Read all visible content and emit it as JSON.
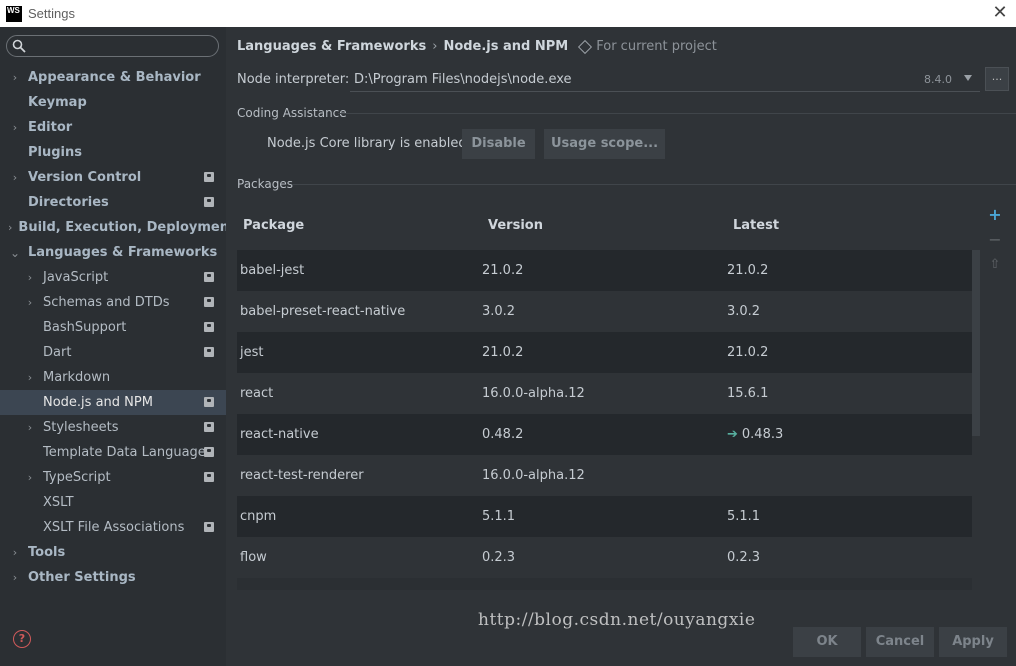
{
  "window": {
    "app_logo": "WS",
    "title": "Settings"
  },
  "sidebar": {
    "items": [
      {
        "label": "Appearance & Behavior",
        "level": 0,
        "expandable": true,
        "expanded": false,
        "project": false,
        "selected": false
      },
      {
        "label": "Keymap",
        "level": 0,
        "expandable": false,
        "project": false,
        "selected": false
      },
      {
        "label": "Editor",
        "level": 0,
        "expandable": true,
        "expanded": false,
        "project": false,
        "selected": false
      },
      {
        "label": "Plugins",
        "level": 0,
        "expandable": false,
        "project": false,
        "selected": false
      },
      {
        "label": "Version Control",
        "level": 0,
        "expandable": true,
        "expanded": false,
        "project": true,
        "selected": false
      },
      {
        "label": "Directories",
        "level": 0,
        "expandable": false,
        "project": true,
        "selected": false
      },
      {
        "label": "Build, Execution, Deployment",
        "level": 0,
        "expandable": true,
        "expanded": false,
        "project": false,
        "selected": false
      },
      {
        "label": "Languages & Frameworks",
        "level": 0,
        "expandable": true,
        "expanded": true,
        "project": false,
        "selected": false
      },
      {
        "label": "JavaScript",
        "level": 1,
        "expandable": true,
        "expanded": false,
        "project": true,
        "selected": false
      },
      {
        "label": "Schemas and DTDs",
        "level": 1,
        "expandable": true,
        "expanded": false,
        "project": true,
        "selected": false
      },
      {
        "label": "BashSupport",
        "level": 1,
        "expandable": false,
        "project": true,
        "selected": false
      },
      {
        "label": "Dart",
        "level": 1,
        "expandable": false,
        "project": true,
        "selected": false
      },
      {
        "label": "Markdown",
        "level": 1,
        "expandable": true,
        "expanded": false,
        "project": false,
        "selected": false
      },
      {
        "label": "Node.js and NPM",
        "level": 1,
        "expandable": false,
        "project": true,
        "selected": true
      },
      {
        "label": "Stylesheets",
        "level": 1,
        "expandable": true,
        "expanded": false,
        "project": true,
        "selected": false
      },
      {
        "label": "Template Data Languages",
        "level": 1,
        "expandable": false,
        "project": true,
        "selected": false
      },
      {
        "label": "TypeScript",
        "level": 1,
        "expandable": true,
        "expanded": false,
        "project": true,
        "selected": false
      },
      {
        "label": "XSLT",
        "level": 1,
        "expandable": false,
        "project": false,
        "selected": false
      },
      {
        "label": "XSLT File Associations",
        "level": 1,
        "expandable": false,
        "project": true,
        "selected": false
      },
      {
        "label": "Tools",
        "level": 0,
        "expandable": true,
        "expanded": false,
        "project": false,
        "selected": false
      },
      {
        "label": "Other Settings",
        "level": 0,
        "expandable": true,
        "expanded": false,
        "project": false,
        "selected": false
      }
    ],
    "help_icon": "?"
  },
  "breadcrumb": {
    "parent": "Languages & Frameworks",
    "separator": "›",
    "current": "Node.js and NPM",
    "scope": "For current project"
  },
  "interpreter": {
    "label": "Node interpreter:",
    "path": "D:\\Program Files\\nodejs\\node.exe",
    "version": "8.4.0",
    "browse_label": "..."
  },
  "coding_assistance": {
    "title": "Coding Assistance",
    "core_text": "Node.js Core library is enabled.",
    "disable_label": "Disable",
    "scope_label": "Usage scope..."
  },
  "packages": {
    "title": "Packages",
    "columns": [
      "Package",
      "Version",
      "Latest"
    ],
    "rows": [
      {
        "package": "babel-jest",
        "version": "21.0.2",
        "latest": "21.0.2",
        "upgrade": false
      },
      {
        "package": "babel-preset-react-native",
        "version": "3.0.2",
        "latest": "3.0.2",
        "upgrade": false
      },
      {
        "package": "jest",
        "version": "21.0.2",
        "latest": "21.0.2",
        "upgrade": false
      },
      {
        "package": "react",
        "version": "16.0.0-alpha.12",
        "latest": "15.6.1",
        "upgrade": false
      },
      {
        "package": "react-native",
        "version": "0.48.2",
        "latest": "0.48.3",
        "upgrade": true
      },
      {
        "package": "react-test-renderer",
        "version": "16.0.0-alpha.12",
        "latest": "",
        "upgrade": false
      },
      {
        "package": "cnpm",
        "version": "5.1.1",
        "latest": "5.1.1",
        "upgrade": false
      },
      {
        "package": "flow",
        "version": "0.2.3",
        "latest": "0.2.3",
        "upgrade": false
      }
    ],
    "tools": {
      "add": "+",
      "remove": "−",
      "upgrade": "⇧"
    }
  },
  "footer": {
    "ok_label": "OK",
    "cancel_label": "Cancel",
    "apply_label": "Apply"
  },
  "watermark": "http://blog.csdn.net/ouyangxie"
}
